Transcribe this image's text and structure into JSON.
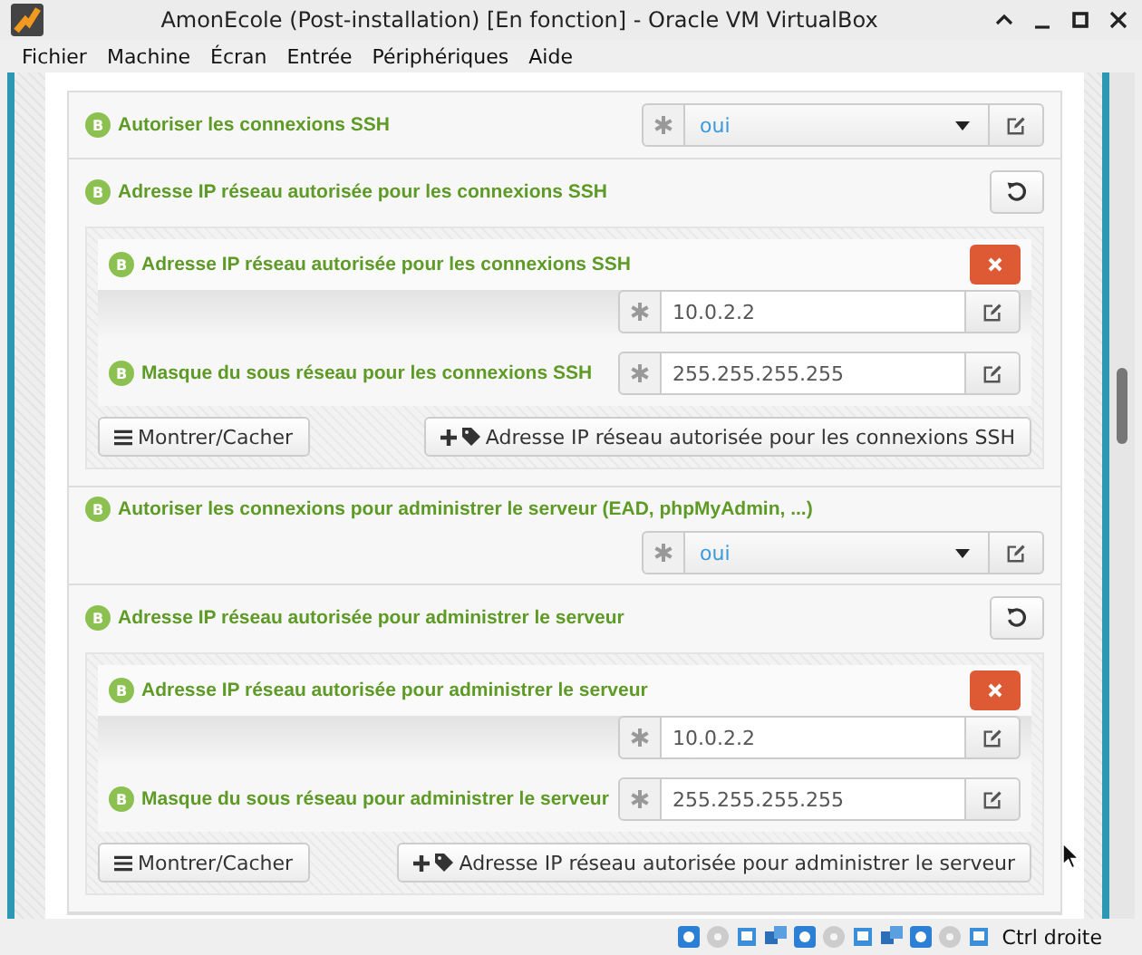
{
  "window": {
    "title": "AmonEcole (Post-installation) [En fonction] - Oracle VM VirtualBox"
  },
  "menu": [
    "Fichier",
    "Machine",
    "Écran",
    "Entrée",
    "Périphériques",
    "Aide"
  ],
  "variables": [
    {
      "kind": "select",
      "badge": "B",
      "label": "Autoriser les connexions SSH",
      "value": "oui"
    },
    {
      "kind": "group",
      "badge": "B",
      "label": "Adresse IP réseau autorisée pour les connexions SSH",
      "entries": [
        {
          "kind": "master",
          "badge": "B",
          "label": "Adresse IP réseau autorisée pour les connexions SSH",
          "value": "10.0.2.2"
        },
        {
          "kind": "slave",
          "badge": "B",
          "label": "Masque du sous réseau pour les connexions SSH",
          "value": "255.255.255.255"
        }
      ],
      "toggle_button": "Montrer/Cacher",
      "add_button": "Adresse IP réseau autorisée pour les connexions SSH"
    },
    {
      "kind": "select",
      "badge": "B",
      "label": "Autoriser les connexions pour administrer le serveur (EAD, phpMyAdmin, ...)",
      "value": "oui"
    },
    {
      "kind": "group",
      "badge": "B",
      "label": "Adresse IP réseau autorisée pour administrer le serveur",
      "entries": [
        {
          "kind": "master",
          "badge": "B",
          "label": "Adresse IP réseau autorisée pour administrer le serveur",
          "value": "10.0.2.2"
        },
        {
          "kind": "slave",
          "badge": "B",
          "label": "Masque du sous réseau pour administrer le serveur",
          "value": "255.255.255.255"
        }
      ],
      "toggle_button": "Montrer/Cacher",
      "add_button": "Adresse IP réseau autorisée pour administrer le serveur"
    }
  ],
  "status_bar": {
    "host_key": "Ctrl droite"
  }
}
